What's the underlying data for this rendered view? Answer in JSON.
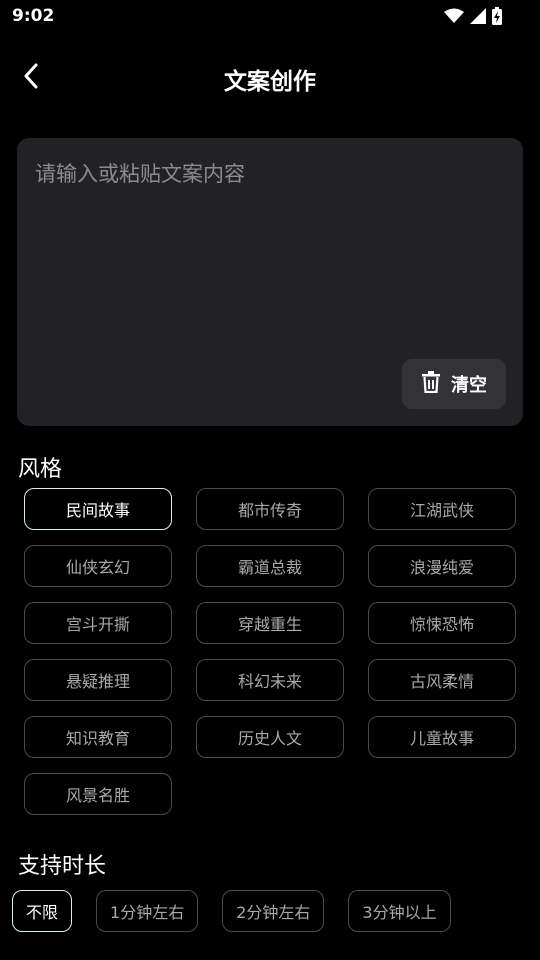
{
  "status_bar": {
    "time": "9:02",
    "icons": [
      "wifi-icon",
      "signal-icon",
      "battery-charging-icon"
    ]
  },
  "header": {
    "title": "文案创作",
    "back_icon": "chevron-left-icon"
  },
  "editor": {
    "placeholder": "请输入或粘贴文案内容",
    "value": "",
    "clear_label": "清空",
    "clear_icon": "trash-icon"
  },
  "style_section": {
    "title": "风格",
    "selected": "民间故事",
    "options": [
      "民间故事",
      "都市传奇",
      "江湖武侠",
      "仙侠玄幻",
      "霸道总裁",
      "浪漫纯爱",
      "宫斗开撕",
      "穿越重生",
      "惊悚恐怖",
      "悬疑推理",
      "科幻未来",
      "古风柔情",
      "知识教育",
      "历史人文",
      "儿童故事",
      "风景名胜"
    ]
  },
  "duration_section": {
    "title": "支持时长",
    "selected": "不限",
    "options": [
      "不限",
      "1分钟左右",
      "2分钟左右",
      "3分钟以上"
    ]
  },
  "colors": {
    "background": "#000000",
    "card": "#222226",
    "chip_border": "#4a4a4f",
    "chip_selected_border": "#d8f2ea"
  }
}
